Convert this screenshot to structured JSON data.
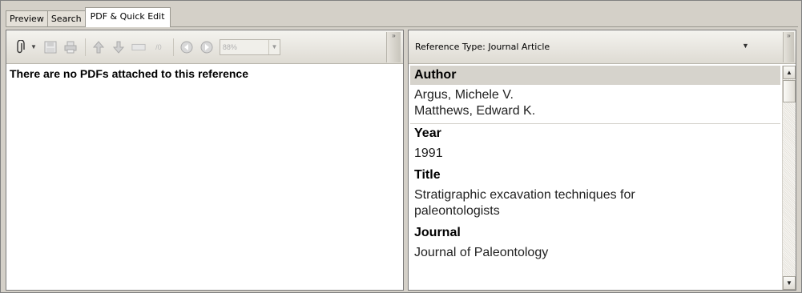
{
  "tabs": [
    {
      "label": "Preview"
    },
    {
      "label": "Search"
    },
    {
      "label": "PDF & Quick Edit"
    }
  ],
  "pdf_pane": {
    "toolbar": {
      "zoom_value": "88%",
      "icons": [
        "paperclip-icon",
        "save-icon",
        "print-icon",
        "first-page-icon",
        "last-page-icon",
        "page-number-icon",
        "page-count-icon",
        "previous-icon",
        "next-icon"
      ]
    },
    "message": "There are no PDFs attached to this reference"
  },
  "edit_pane": {
    "reference_type": "Reference Type: Journal Article",
    "fields": [
      {
        "label": "Author",
        "lines": [
          "Argus, Michele V.",
          "Matthews, Edward K."
        ]
      },
      {
        "label": "Year",
        "lines": [
          "1991"
        ]
      },
      {
        "label": "Title",
        "lines": [
          "Stratigraphic excavation techniques for",
          "paleontologists"
        ]
      },
      {
        "label": "Journal",
        "lines": [
          "Journal of Paleontology"
        ]
      }
    ]
  },
  "colors": {
    "frame": "#d4d0c8",
    "selected_label_bg": "#d6d3cc"
  }
}
